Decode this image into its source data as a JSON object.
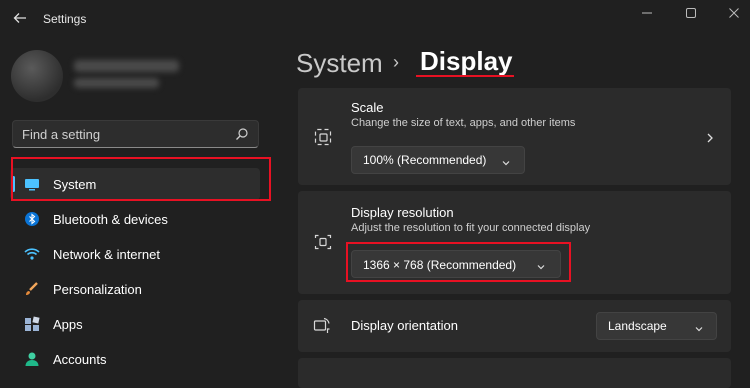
{
  "window": {
    "title": "Settings"
  },
  "search": {
    "placeholder": "Find a setting"
  },
  "sidebar": {
    "items": [
      {
        "label": "System",
        "icon": "monitor-icon",
        "active": true
      },
      {
        "label": "Bluetooth & devices",
        "icon": "bluetooth-icon"
      },
      {
        "label": "Network & internet",
        "icon": "wifi-icon"
      },
      {
        "label": "Personalization",
        "icon": "brush-icon"
      },
      {
        "label": "Apps",
        "icon": "apps-icon"
      },
      {
        "label": "Accounts",
        "icon": "person-icon"
      }
    ]
  },
  "breadcrumb": {
    "parent": "System",
    "separator": "›",
    "current": "Display"
  },
  "scale": {
    "title": "Scale",
    "subtitle": "Change the size of text, apps, and other items",
    "value": "100% (Recommended)"
  },
  "resolution": {
    "title": "Display resolution",
    "subtitle": "Adjust the resolution to fit your connected display",
    "value": "1366 × 768 (Recommended)"
  },
  "orientation": {
    "title": "Display orientation",
    "value": "Landscape"
  },
  "colors": {
    "accent": "#4cc2ff",
    "highlight": "#e81123",
    "background": "#202020",
    "card": "#2b2b2b"
  }
}
